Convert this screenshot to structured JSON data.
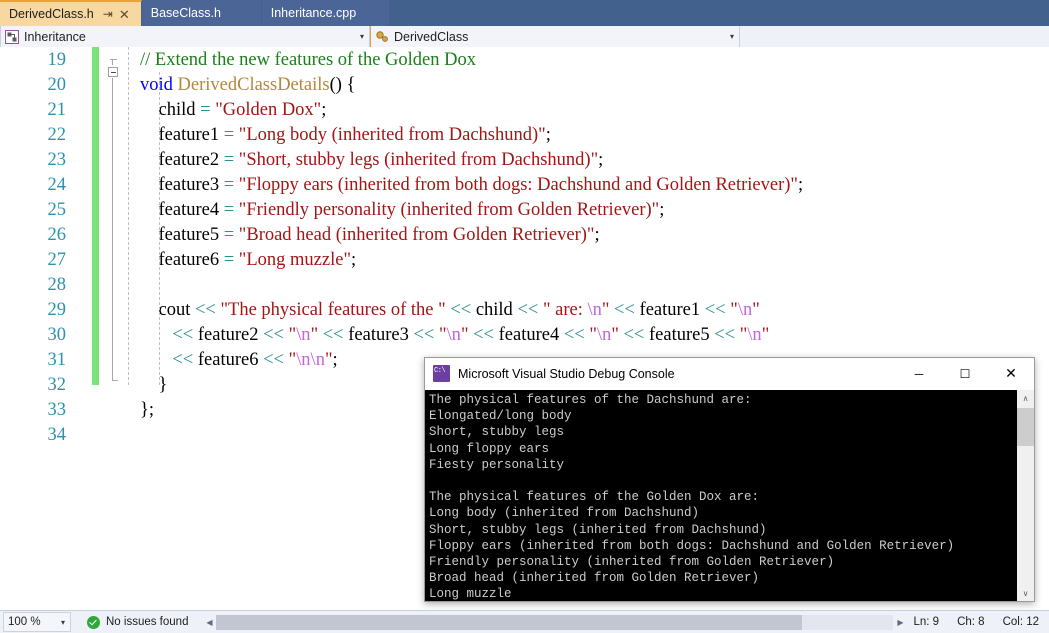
{
  "tabs": [
    {
      "label": "DerivedClass.h",
      "active": true,
      "pin_icon": "⇥",
      "close_icon": "✕"
    },
    {
      "label": "BaseClass.h",
      "active": false
    },
    {
      "label": "Inheritance.cpp",
      "active": false
    }
  ],
  "nav_bar": {
    "left": {
      "icon": "project-icon",
      "value": "Inheritance",
      "arrow": "▾"
    },
    "right": {
      "icon": "class-icon",
      "value": "DerivedClass",
      "arrow": "▾"
    }
  },
  "editor": {
    "first_line": 19,
    "lines": [
      {
        "n": 19,
        "tokens": [
          {
            "t": "comment",
            "s": "// Extend the new features of the Golden Dox"
          }
        ]
      },
      {
        "n": 20,
        "tokens": [
          {
            "t": "kw",
            "s": "void"
          },
          {
            "t": "plain",
            "s": " "
          },
          {
            "t": "type",
            "s": "DerivedClassDetails"
          },
          {
            "t": "plain",
            "s": "() {"
          }
        ]
      },
      {
        "n": 21,
        "tokens": [
          {
            "t": "plain",
            "s": "    child "
          },
          {
            "t": "op",
            "s": "="
          },
          {
            "t": "plain",
            "s": " "
          },
          {
            "t": "str",
            "s": "\"Golden Dox\""
          },
          {
            "t": "plain",
            "s": ";"
          }
        ]
      },
      {
        "n": 22,
        "tokens": [
          {
            "t": "plain",
            "s": "    feature1 "
          },
          {
            "t": "op",
            "s": "="
          },
          {
            "t": "plain",
            "s": " "
          },
          {
            "t": "str",
            "s": "\"Long body (inherited from Dachshund)\""
          },
          {
            "t": "plain",
            "s": ";"
          }
        ]
      },
      {
        "n": 23,
        "tokens": [
          {
            "t": "plain",
            "s": "    feature2 "
          },
          {
            "t": "op",
            "s": "="
          },
          {
            "t": "plain",
            "s": " "
          },
          {
            "t": "str",
            "s": "\"Short, stubby legs (inherited from Dachshund)\""
          },
          {
            "t": "plain",
            "s": ";"
          }
        ]
      },
      {
        "n": 24,
        "tokens": [
          {
            "t": "plain",
            "s": "    feature3 "
          },
          {
            "t": "op",
            "s": "="
          },
          {
            "t": "plain",
            "s": " "
          },
          {
            "t": "str",
            "s": "\"Floppy ears (inherited from both dogs: Dachshund and Golden Retriever)\""
          },
          {
            "t": "plain",
            "s": ";"
          }
        ]
      },
      {
        "n": 25,
        "tokens": [
          {
            "t": "plain",
            "s": "    feature4 "
          },
          {
            "t": "op",
            "s": "="
          },
          {
            "t": "plain",
            "s": " "
          },
          {
            "t": "str",
            "s": "\"Friendly personality (inherited from Golden Retriever)\""
          },
          {
            "t": "plain",
            "s": ";"
          }
        ]
      },
      {
        "n": 26,
        "tokens": [
          {
            "t": "plain",
            "s": "    feature5 "
          },
          {
            "t": "op",
            "s": "="
          },
          {
            "t": "plain",
            "s": " "
          },
          {
            "t": "str",
            "s": "\"Broad head (inherited from Golden Retriever)\""
          },
          {
            "t": "plain",
            "s": ";"
          }
        ]
      },
      {
        "n": 27,
        "tokens": [
          {
            "t": "plain",
            "s": "    feature6 "
          },
          {
            "t": "op",
            "s": "="
          },
          {
            "t": "plain",
            "s": " "
          },
          {
            "t": "str",
            "s": "\"Long muzzle\""
          },
          {
            "t": "plain",
            "s": ";"
          }
        ]
      },
      {
        "n": 28,
        "tokens": []
      },
      {
        "n": 29,
        "tokens": [
          {
            "t": "plain",
            "s": "    cout "
          },
          {
            "t": "op",
            "s": "<<"
          },
          {
            "t": "plain",
            "s": " "
          },
          {
            "t": "str",
            "s": "\"The physical features of the \""
          },
          {
            "t": "plain",
            "s": " "
          },
          {
            "t": "op",
            "s": "<<"
          },
          {
            "t": "plain",
            "s": " child "
          },
          {
            "t": "op",
            "s": "<<"
          },
          {
            "t": "plain",
            "s": " "
          },
          {
            "t": "str",
            "s": "\" are: "
          },
          {
            "t": "esc",
            "s": "\\n"
          },
          {
            "t": "str",
            "s": "\""
          },
          {
            "t": "plain",
            "s": " "
          },
          {
            "t": "op",
            "s": "<<"
          },
          {
            "t": "plain",
            "s": " feature1 "
          },
          {
            "t": "op",
            "s": "<<"
          },
          {
            "t": "plain",
            "s": " "
          },
          {
            "t": "str",
            "s": "\""
          },
          {
            "t": "esc",
            "s": "\\n"
          },
          {
            "t": "str",
            "s": "\""
          }
        ]
      },
      {
        "n": 30,
        "tokens": [
          {
            "t": "plain",
            "s": "       "
          },
          {
            "t": "op",
            "s": "<<"
          },
          {
            "t": "plain",
            "s": " feature2 "
          },
          {
            "t": "op",
            "s": "<<"
          },
          {
            "t": "plain",
            "s": " "
          },
          {
            "t": "str",
            "s": "\""
          },
          {
            "t": "esc",
            "s": "\\n"
          },
          {
            "t": "str",
            "s": "\""
          },
          {
            "t": "plain",
            "s": " "
          },
          {
            "t": "op",
            "s": "<<"
          },
          {
            "t": "plain",
            "s": " feature3 "
          },
          {
            "t": "op",
            "s": "<<"
          },
          {
            "t": "plain",
            "s": " "
          },
          {
            "t": "str",
            "s": "\""
          },
          {
            "t": "esc",
            "s": "\\n"
          },
          {
            "t": "str",
            "s": "\""
          },
          {
            "t": "plain",
            "s": " "
          },
          {
            "t": "op",
            "s": "<<"
          },
          {
            "t": "plain",
            "s": " feature4 "
          },
          {
            "t": "op",
            "s": "<<"
          },
          {
            "t": "plain",
            "s": " "
          },
          {
            "t": "str",
            "s": "\""
          },
          {
            "t": "esc",
            "s": "\\n"
          },
          {
            "t": "str",
            "s": "\""
          },
          {
            "t": "plain",
            "s": " "
          },
          {
            "t": "op",
            "s": "<<"
          },
          {
            "t": "plain",
            "s": " feature5 "
          },
          {
            "t": "op",
            "s": "<<"
          },
          {
            "t": "plain",
            "s": " "
          },
          {
            "t": "str",
            "s": "\""
          },
          {
            "t": "esc",
            "s": "\\n"
          },
          {
            "t": "str",
            "s": "\""
          }
        ]
      },
      {
        "n": 31,
        "tokens": [
          {
            "t": "plain",
            "s": "       "
          },
          {
            "t": "op",
            "s": "<<"
          },
          {
            "t": "plain",
            "s": " feature6 "
          },
          {
            "t": "op",
            "s": "<<"
          },
          {
            "t": "plain",
            "s": " "
          },
          {
            "t": "str",
            "s": "\""
          },
          {
            "t": "esc",
            "s": "\\n\\n"
          },
          {
            "t": "str",
            "s": "\""
          },
          {
            "t": "plain",
            "s": ";"
          }
        ]
      },
      {
        "n": 32,
        "tokens": [
          {
            "t": "plain",
            "s": "    }"
          }
        ]
      },
      {
        "n": 33,
        "tokens": [
          {
            "t": "plain",
            "s": "};"
          }
        ]
      },
      {
        "n": 34,
        "tokens": []
      }
    ]
  },
  "console": {
    "title": "Microsoft Visual Studio Debug Console",
    "icon": "console-icon",
    "minimize_icon": "─",
    "maximize_icon": "☐",
    "close_icon": "✕",
    "scroll_up_icon": "∧",
    "scroll_down_icon": "∨",
    "output": "The physical features of the Dachshund are:\nElongated/long body\nShort, stubby legs\nLong floppy ears\nFiesty personality\n\nThe physical features of the Golden Dox are:\nLong body (inherited from Dachshund)\nShort, stubby legs (inherited from Dachshund)\nFloppy ears (inherited from both dogs: Dachshund and Golden Retriever)\nFriendly personality (inherited from Golden Retriever)\nBroad head (inherited from Golden Retriever)\nLong muzzle"
  },
  "status_bar": {
    "zoom": "100 %",
    "zoom_arrow": "▾",
    "issues": "No issues found",
    "issues_icon": "check-circle-icon",
    "scroll_left_icon": "◀",
    "scroll_right_icon": "▶",
    "line": "Ln: 9",
    "char": "Ch: 8",
    "col": "Col: 12"
  },
  "colors": {
    "tab_strip_bg": "#42618c",
    "tab_active_bg": "#f6d8a0",
    "tab_accent": "#e8a33d",
    "change_bar": "#79e47a",
    "comment": "#1a7f1a",
    "keyword": "#0000ff",
    "type": "#b5873a",
    "string": "#a31515",
    "operator": "#2f8f8f",
    "escape": "#c264e0",
    "linenumber": "#2b91af",
    "console_bg": "#000000",
    "console_fg": "#cccccc",
    "status_ok": "#2ea839"
  }
}
